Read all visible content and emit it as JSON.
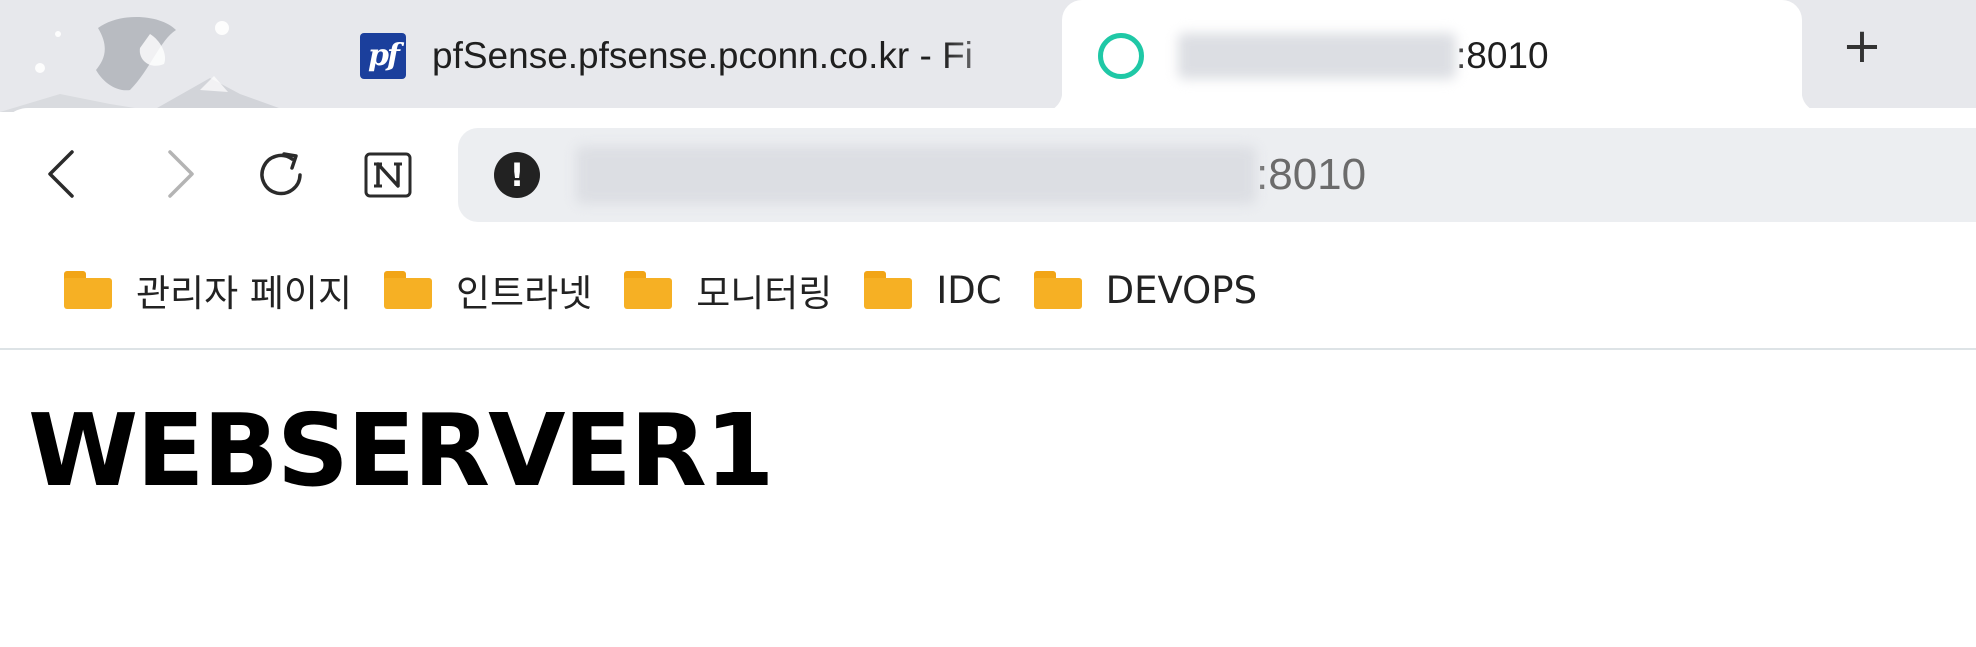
{
  "tabs": [
    {
      "title": "pfSense.pfsense.pconn.co.kr - Fi",
      "favicon": "pfsense-logo",
      "active": false
    },
    {
      "title_suffix": ":8010",
      "favicon": "loading-ring-icon",
      "active": true
    }
  ],
  "new_tab_label": "+",
  "toolbar": {
    "back_icon": "chevron-left-icon",
    "forward_icon": "chevron-right-icon",
    "reload_icon": "reload-icon",
    "extension_icon": "notion-icon",
    "security_icon": "info-icon",
    "security_glyph": "!",
    "url_suffix": ":8010"
  },
  "bookmarks": [
    {
      "label": "관리자 페이지"
    },
    {
      "label": "인트라넷"
    },
    {
      "label": "모니터링"
    },
    {
      "label": "IDC"
    },
    {
      "label": "DEVOPS"
    }
  ],
  "page": {
    "heading": "WEBSERVER1"
  },
  "colors": {
    "tabstrip_bg": "#e7e8ec",
    "omnibox_bg": "#eceef1",
    "folder": "#f6b024",
    "loading_ring": "#1fc8a6"
  }
}
